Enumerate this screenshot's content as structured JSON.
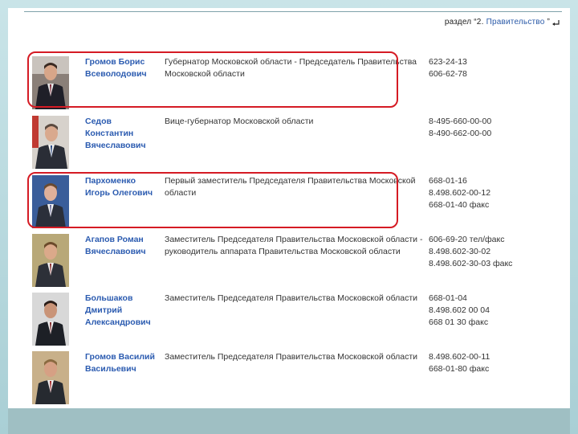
{
  "header": {
    "breadcrumb_prefix": "раздел “2.",
    "breadcrumb_section": "Правительство",
    "breadcrumb_suffix": "”"
  },
  "rows": [
    {
      "name_lines": [
        "Громов Борис",
        "Всеволодович"
      ],
      "position": "Губернатор Московской области - Председатель Правительства Московской области",
      "phones": [
        "623-24-13",
        "606-62-78"
      ],
      "highlighted": true
    },
    {
      "name_lines": [
        "Седов",
        "Константин",
        "Вячеславович"
      ],
      "position": "Вице-губернатор Московской области",
      "phones": [
        "8-495-660-00-00",
        "8-490-662-00-00"
      ],
      "highlighted": false
    },
    {
      "name_lines": [
        "Пархоменко",
        "Игорь Олегович"
      ],
      "position": "Первый заместитель Председателя Правительства Московской области",
      "phones": [
        "668-01-16",
        "8.498.602-00-12",
        "668-01-40 факс"
      ],
      "highlighted": true
    },
    {
      "name_lines": [
        "Агапов Роман",
        "Вячеславович"
      ],
      "position": "Заместитель Председателя Правительства Московской области - руководитель аппарата Правительства Московской области",
      "phones": [
        "606-69-20 тел/факс",
        "8.498.602-30-02",
        "8.498.602-30-03 факс"
      ],
      "highlighted": false
    },
    {
      "name_lines": [
        "Большаков",
        "Дмитрий",
        "Александрович"
      ],
      "position": "Заместитель Председателя Правительства Московской области",
      "phones": [
        "668-01-04",
        "8.498.602 00 04",
        "668 01 30 факс"
      ],
      "highlighted": false
    },
    {
      "name_lines": [
        "Громов Василий",
        "Васильевич"
      ],
      "position": "Заместитель Председателя Правительства Московской области",
      "phones": [
        "8.498.602-00-11",
        "668-01-80 факс"
      ],
      "highlighted": false
    }
  ],
  "colors": {
    "name_link": "#2b5bb0",
    "highlight_border": "#d51b24",
    "background_teal": "#a9cfd5"
  }
}
